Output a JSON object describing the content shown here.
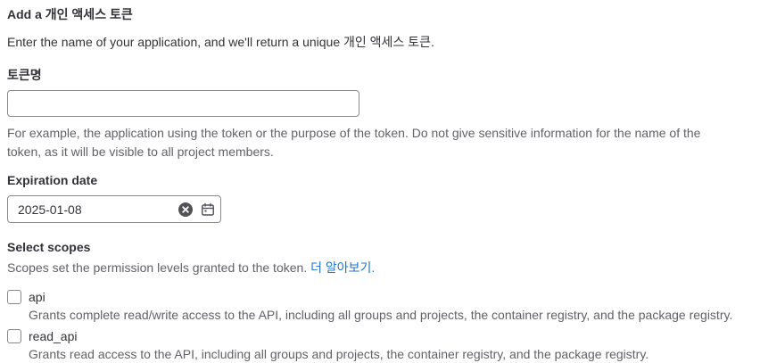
{
  "header": {
    "title": "Add a 개인 액세스 토큰",
    "description": "Enter the name of your application, and we'll return a unique 개인 액세스 토큰."
  },
  "token_name": {
    "label": "토큰명",
    "value": "",
    "help": "For example, the application using the token or the purpose of the token. Do not give sensitive information for the name of the token, as it will be visible to all project members."
  },
  "expiration": {
    "label": "Expiration date",
    "value": "2025-01-08",
    "clear_icon": "clear-circle-icon",
    "calendar_icon": "calendar-icon"
  },
  "scopes": {
    "label": "Select scopes",
    "help_text": "Scopes set the permission levels granted to the token.",
    "learn_more": "더 알아보기.",
    "items": [
      {
        "name": "api",
        "checked": false,
        "description": "Grants complete read/write access to the API, including all groups and projects, the container registry, and the package registry."
      },
      {
        "name": "read_api",
        "checked": false,
        "description": "Grants read access to the API, including all groups and projects, the container registry, and the package registry."
      }
    ]
  },
  "colors": {
    "text": "#333238",
    "muted": "#626168",
    "link": "#1f75cb",
    "border": "#89888d"
  }
}
